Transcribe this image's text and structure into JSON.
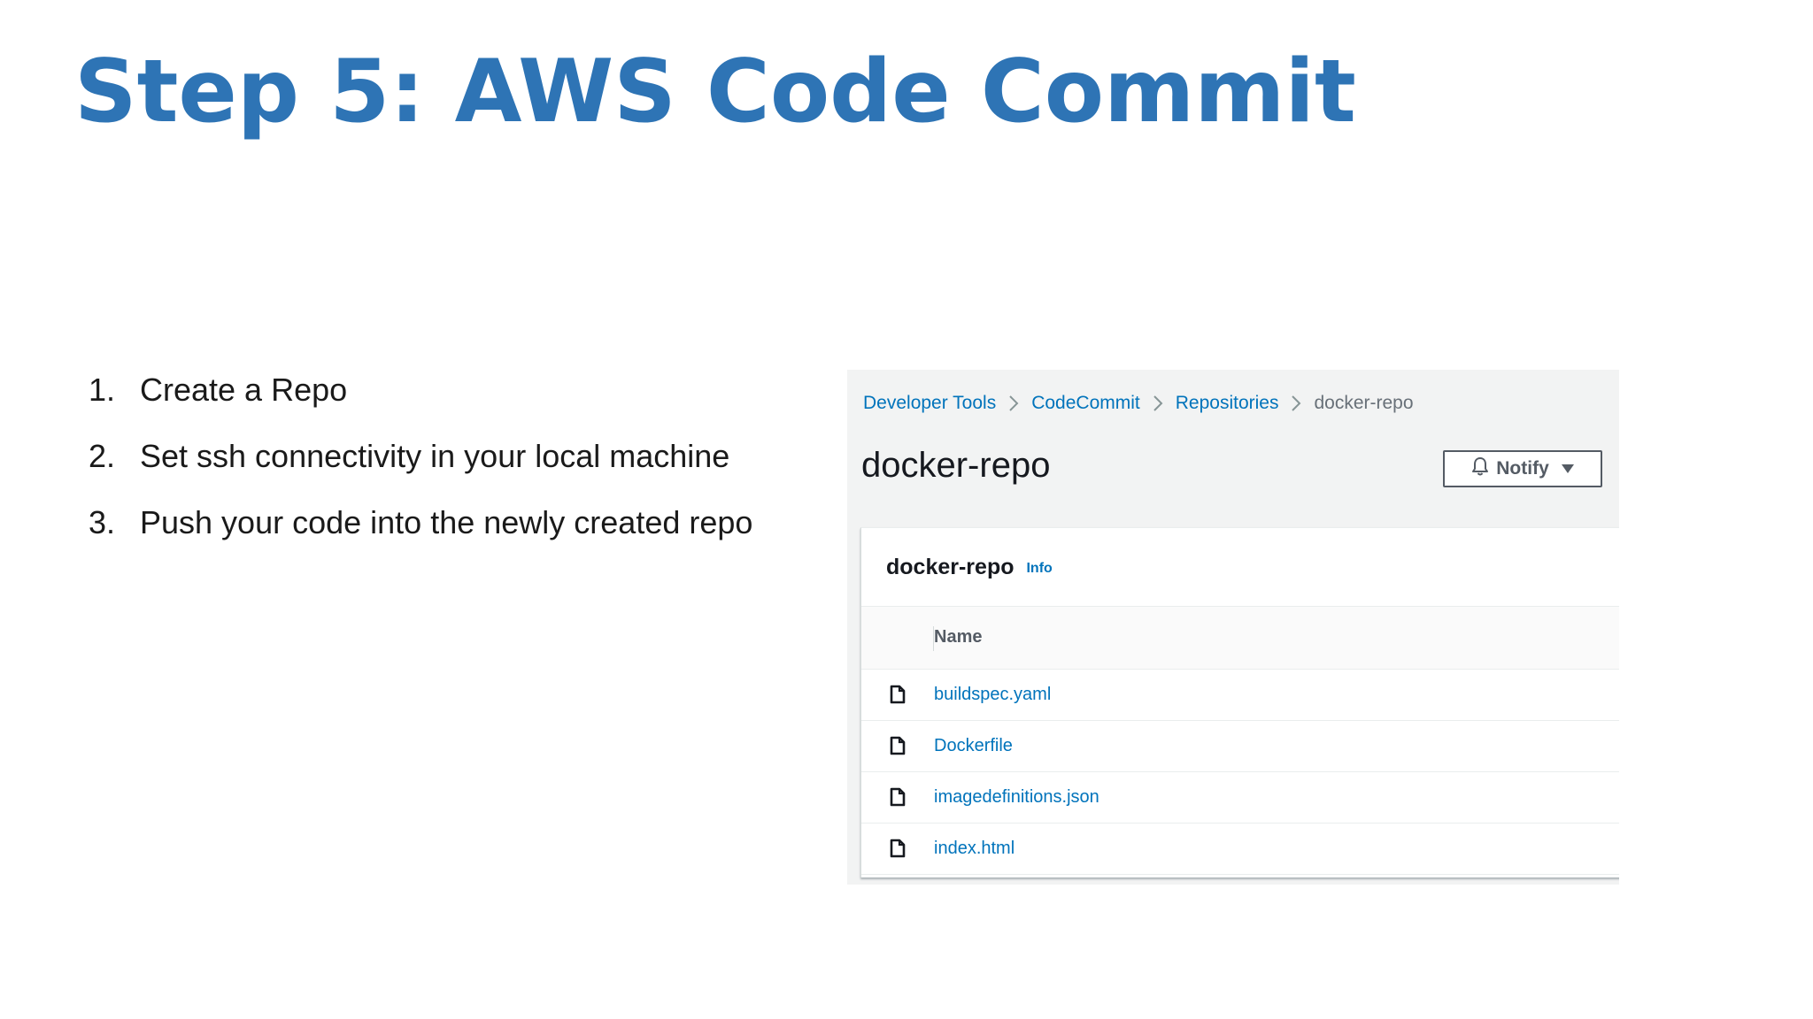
{
  "slide": {
    "title": "Step 5: AWS Code Commit",
    "steps": [
      {
        "number": "1.",
        "text": "Create a Repo"
      },
      {
        "number": "2.",
        "text": "Set ssh connectivity in your local machine"
      },
      {
        "number": "3.",
        "text": "Push your code into the newly created repo"
      }
    ]
  },
  "console": {
    "breadcrumb": [
      "Developer Tools",
      "CodeCommit",
      "Repositories",
      "docker-repo"
    ],
    "page_title": "docker-repo",
    "notify_button": {
      "label": "Notify",
      "icon": "bell-icon"
    },
    "card": {
      "title": "docker-repo",
      "info_link": "Info",
      "table_header": "Name",
      "files": [
        {
          "name": "buildspec.yaml",
          "icon": "file-icon"
        },
        {
          "name": "Dockerfile",
          "icon": "file-icon"
        },
        {
          "name": "imagedefinitions.json",
          "icon": "file-icon"
        },
        {
          "name": "index.html",
          "icon": "file-icon"
        }
      ]
    }
  },
  "colors": {
    "title_blue": "#2e74b5",
    "link_blue": "#0073bb",
    "panel_gray": "#f2f3f3"
  }
}
